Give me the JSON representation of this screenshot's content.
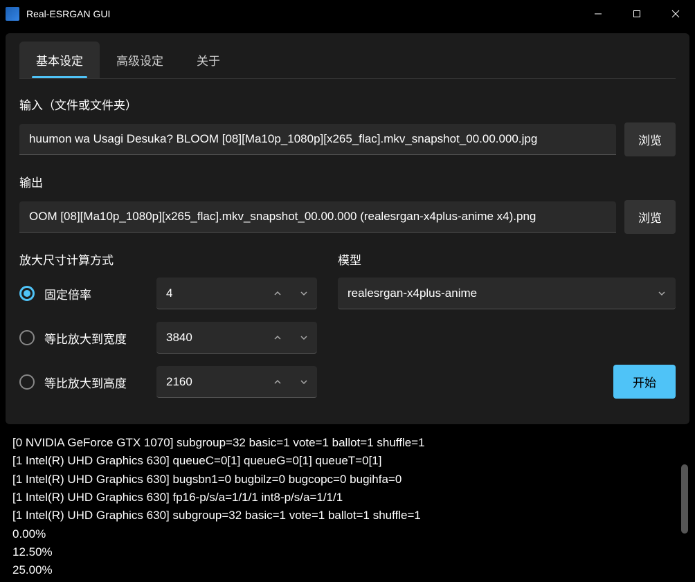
{
  "titlebar": {
    "title": "Real-ESRGAN GUI"
  },
  "tabs": [
    {
      "label": "基本设定",
      "active": true
    },
    {
      "label": "高级设定",
      "active": false
    },
    {
      "label": "关于",
      "active": false
    }
  ],
  "form": {
    "input_label": "输入（文件或文件夹）",
    "input_value": "huumon wa Usagi Desuka? BLOOM [08][Ma10p_1080p][x265_flac].mkv_snapshot_00.00.000.jpg",
    "input_browse": "浏览",
    "output_label": "输出",
    "output_value": "OOM [08][Ma10p_1080p][x265_flac].mkv_snapshot_00.00.000 (realesrgan-x4plus-anime x4).png",
    "output_browse": "浏览",
    "scale_label": "放大尺寸计算方式",
    "model_label": "模型",
    "radios": {
      "fixed": {
        "label": "固定倍率",
        "value": "4",
        "selected": true
      },
      "width": {
        "label": "等比放大到宽度",
        "value": "3840",
        "selected": false
      },
      "height": {
        "label": "等比放大到高度",
        "value": "2160",
        "selected": false
      }
    },
    "model_value": "realesrgan-x4plus-anime",
    "start_label": "开始"
  },
  "log_lines": [
    "[0 NVIDIA GeForce GTX 1070]  subgroup=32  basic=1  vote=1  ballot=1  shuffle=1",
    "[1 Intel(R) UHD Graphics 630]  queueC=0[1]  queueG=0[1]  queueT=0[1]",
    "[1 Intel(R) UHD Graphics 630]  bugsbn1=0  bugbilz=0  bugcopc=0  bugihfa=0",
    "[1 Intel(R) UHD Graphics 630]  fp16-p/s/a=1/1/1  int8-p/s/a=1/1/1",
    "[1 Intel(R) UHD Graphics 630]  subgroup=32  basic=1  vote=1  ballot=1  shuffle=1",
    "0.00%",
    "12.50%",
    "25.00%"
  ]
}
